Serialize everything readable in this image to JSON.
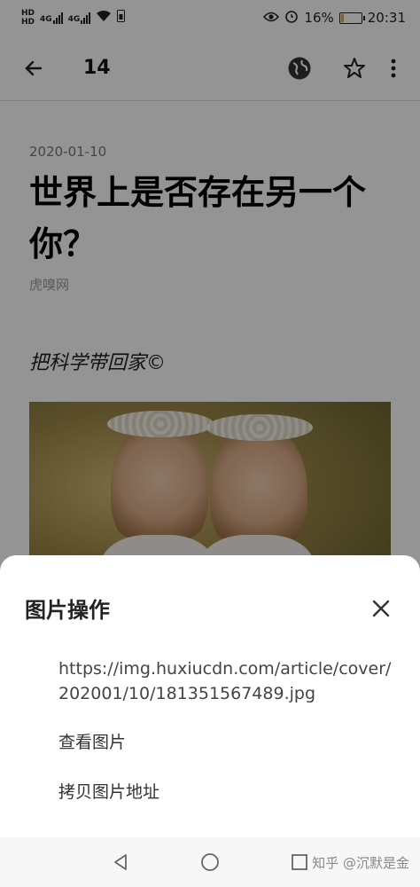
{
  "status_bar": {
    "hd1": "HD",
    "hd2": "HD",
    "net1": "4G",
    "net2": "4G",
    "battery_text": "16%",
    "battery_level": 0.16,
    "time": "20:31"
  },
  "toolbar": {
    "title": "14"
  },
  "article": {
    "date": "2020-01-10",
    "title": "世界上是否存在另一个你？",
    "source": "虎嗅网",
    "subhead": "把科学带回家©"
  },
  "sheet": {
    "title": "图片操作",
    "url": "https://img.huxiucdn.com/article/cover/202001/10/181351567489.jpg",
    "view_label": "查看图片",
    "copy_label": "拷贝图片地址"
  },
  "watermark": "知乎 @沉默是金",
  "colors": {
    "battery": "#f0a22a",
    "scrim": "rgba(0,0,0,0.42)"
  }
}
